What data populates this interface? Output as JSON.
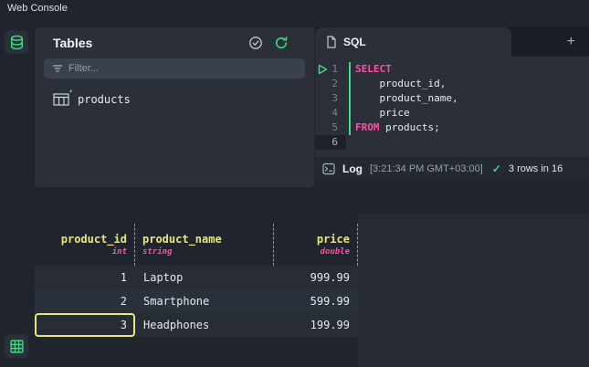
{
  "app": {
    "title": "Web Console"
  },
  "colors": {
    "accent_green": "#3ddc84",
    "keyword_pink": "#ff4fa8",
    "header_yellow": "#e8e878",
    "selection_yellow": "#e8e878",
    "panel_bg": "#2a2f38",
    "page_bg": "#20252d"
  },
  "sidebar": {
    "icons": [
      {
        "name": "database-icon"
      },
      {
        "name": "table-grid-icon"
      }
    ]
  },
  "tables_panel": {
    "title": "Tables",
    "filter_placeholder": "Filter...",
    "header_icons": [
      {
        "name": "check-circle-icon"
      },
      {
        "name": "refresh-icon"
      }
    ],
    "items": [
      {
        "label": "products",
        "icon": "table-icon"
      }
    ]
  },
  "sql_panel": {
    "tab_label": "SQL",
    "add_tab_label": "+",
    "lines": [
      {
        "num": "1",
        "segments": [
          {
            "type": "keyword",
            "text": "SELECT"
          }
        ]
      },
      {
        "num": "2",
        "segments": [
          {
            "type": "plain",
            "text": "    product_id,"
          }
        ]
      },
      {
        "num": "3",
        "segments": [
          {
            "type": "plain",
            "text": "    product_name,"
          }
        ]
      },
      {
        "num": "4",
        "segments": [
          {
            "type": "plain",
            "text": "    price"
          }
        ]
      },
      {
        "num": "5",
        "segments": [
          {
            "type": "keyword",
            "text": "FROM"
          },
          {
            "type": "plain",
            "text": " products;"
          }
        ]
      },
      {
        "num": "6",
        "segments": [],
        "current": true
      }
    ]
  },
  "log_bar": {
    "label": "Log",
    "timestamp": "[3:21:34 PM GMT+03:00]",
    "check": "✓",
    "status": "3 rows in 16"
  },
  "results": {
    "columns": [
      {
        "name": "product_id",
        "type": "int",
        "align": "right"
      },
      {
        "name": "product_name",
        "type": "string",
        "align": "left"
      },
      {
        "name": "price",
        "type": "double",
        "align": "right"
      }
    ],
    "rows": [
      [
        "1",
        "Laptop",
        "999.99"
      ],
      [
        "2",
        "Smartphone",
        "599.99"
      ],
      [
        "3",
        "Headphones",
        "199.99"
      ]
    ],
    "selected_cell": {
      "row": 2,
      "col": 0
    }
  }
}
